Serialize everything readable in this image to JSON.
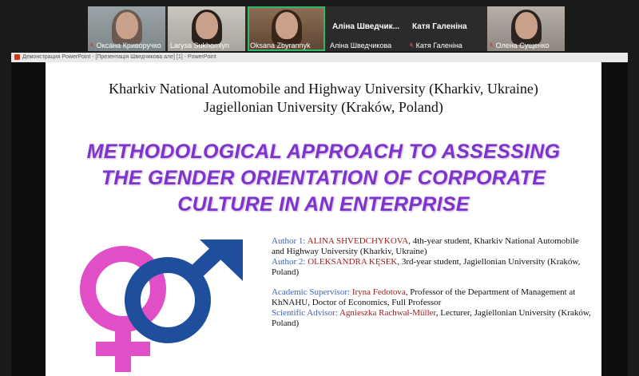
{
  "participants": [
    {
      "name": "Оксана Криворучко",
      "muted": true
    },
    {
      "name": "Larysa Sukhomlyn",
      "muted": false
    },
    {
      "name": "Oksana Zbyrannyk",
      "muted": false
    },
    {
      "name": "Аліна Шведчикова",
      "display": "Аліна Шведчик...",
      "muted": false
    },
    {
      "name": "Катя Галеніна",
      "muted": true
    },
    {
      "name": "Олена Сущенко",
      "muted": true
    }
  ],
  "window": {
    "title": "Демонстрация PowerPoint - [Презентація Шведчикова але] [1] - PowerPoint"
  },
  "slide": {
    "uni1": "Kharkiv National Automobile and Highway University (Kharkiv, Ukraine)",
    "uni2": "Jagiellonian University (Kraków, Poland)",
    "title": [
      "METHODOLOGICAL APPROACH TO ASSESSING",
      "THE GENDER ORIENTATION OF CORPORATE",
      "CULTURE IN AN ENTERPRISE"
    ],
    "author1_label": "Author 1: ",
    "author1_name": "ALINA SHVEDCHYKOVA",
    "author1_rest": ", 4th-year student, Kharkiv National Automobile and Highway University (Kharkiv, Ukraine)",
    "author2_label": "Author 2: ",
    "author2_name": "OLEKSANDRA KĘSEK",
    "author2_rest": ", 3rd-year student, Jagiellonian University (Kraków, Poland)",
    "sup_label": "Academic Supervisor: ",
    "sup_name": "Iryna Fedotova",
    "sup_rest": ", Professor of the Department of Management at KhNAHU, Doctor of Economics, Full Professor",
    "adv_label": "Scientific Advisor: ",
    "adv_name": "Agnieszka Rachwał-Müller",
    "adv_rest": ", Lecturer, Jagiellonian University (Kraków, Poland)"
  },
  "colors": {
    "title": "#7e33cc",
    "label": "#3d63b0",
    "name": "#9a1b1b",
    "female": "#e14fc7",
    "male": "#1f4f9c",
    "active": "#2fb86a"
  },
  "icons": [
    "mic-muted-icon",
    "female-symbol-icon",
    "male-symbol-icon",
    "powerpoint-icon"
  ]
}
